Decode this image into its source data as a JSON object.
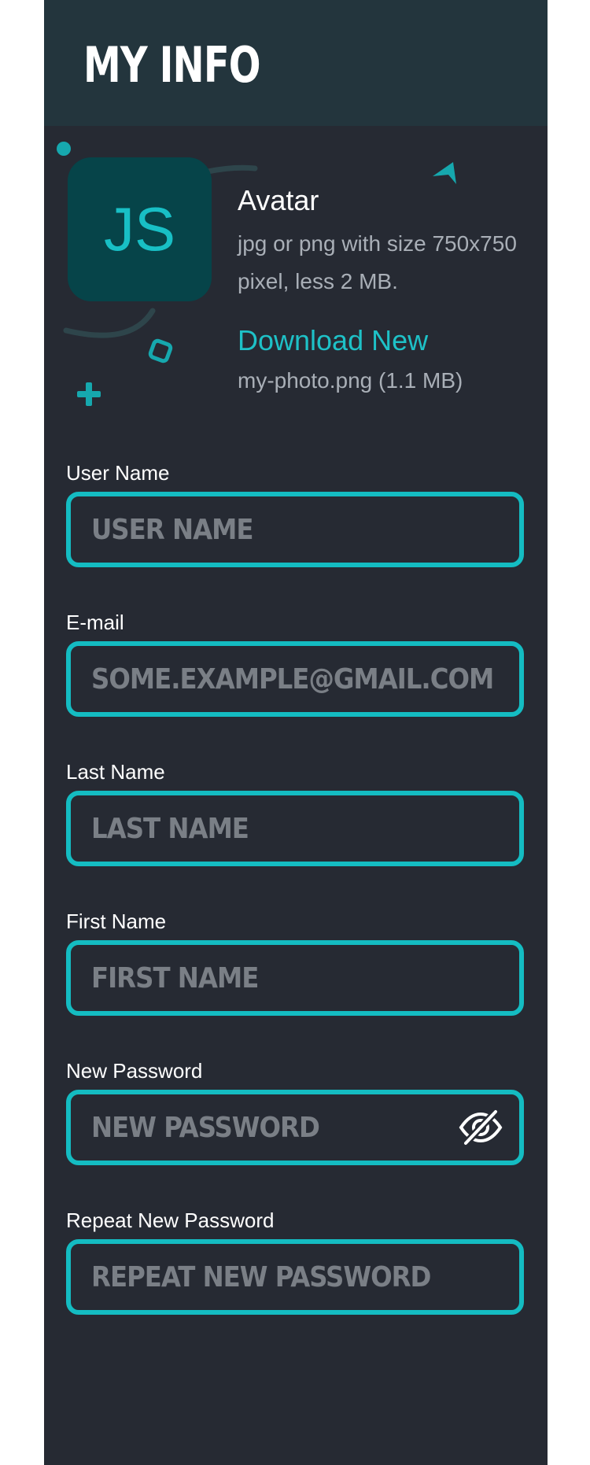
{
  "header": {
    "title": "MY INFO"
  },
  "avatar": {
    "initials": "JS",
    "title": "Avatar",
    "hint": "jpg or png with size 750x750 pixel, less 2 MB.",
    "download_label": "Download New",
    "file_info": "my-photo.png (1.1 MB)"
  },
  "fields": {
    "username": {
      "label": "User Name",
      "placeholder": "USER NAME"
    },
    "email": {
      "label": "E-mail",
      "placeholder": "SOME.EXAMPLE@GMAIL.COM"
    },
    "last_name": {
      "label": "Last Name",
      "placeholder": "LAST NAME"
    },
    "first_name": {
      "label": "First Name",
      "placeholder": "FIRST NAME"
    },
    "new_password": {
      "label": "New Password",
      "placeholder": "NEW PASSWORD",
      "toggle_icon": "eye-off-icon"
    },
    "repeat_password": {
      "label": "Repeat New Password",
      "placeholder": "REPEAT NEW PASSWORD"
    }
  },
  "colors": {
    "accent": "#14bcc2",
    "panel": "#262a33",
    "header": "#23353d",
    "avatar_bg": "#064449"
  }
}
